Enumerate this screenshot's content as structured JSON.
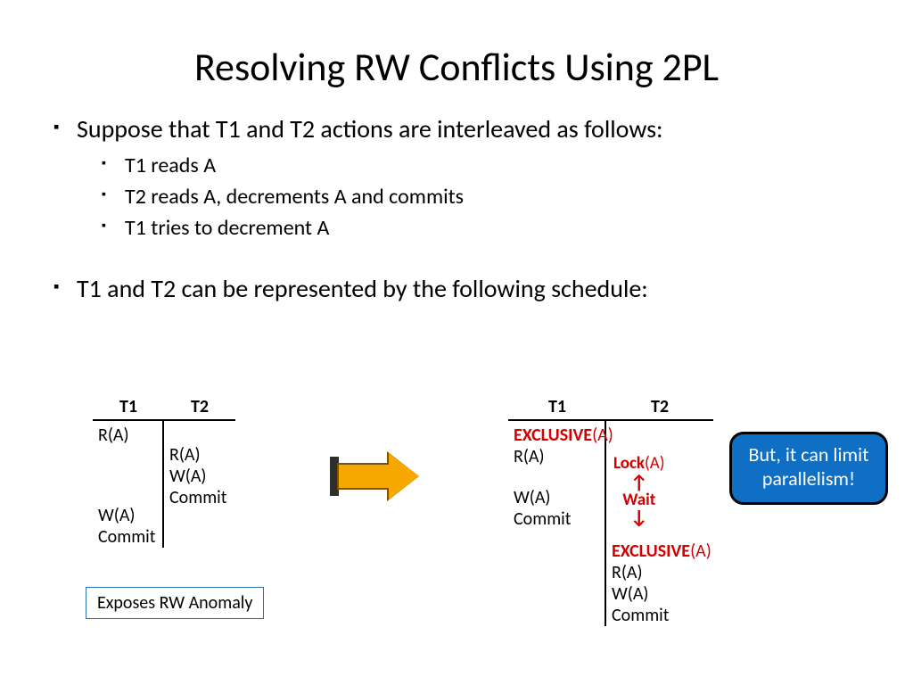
{
  "title": "Resolving RW Conflicts Using 2PL",
  "bullets": {
    "b1a": "Suppose that T1 and T2 actions are interleaved as follows:",
    "b2a": "T1 reads A",
    "b2b": "T2 reads A, decrements A and commits",
    "b2c": "T1 tries to decrement A",
    "b1b": "T1 and T2 can be represented by the following schedule:"
  },
  "left_table": {
    "h1": "T1",
    "h2": "T2",
    "t1": [
      "R(A)",
      "",
      "",
      "",
      "W(A)",
      "Commit"
    ],
    "t2": [
      "",
      "R(A)",
      "W(A)",
      "Commit",
      "",
      ""
    ]
  },
  "right_table": {
    "h1": "T1",
    "h2": "T2",
    "t1_ex": "EXCLUSIVE",
    "t1_exarg": "(A)",
    "t1": [
      "R(A)",
      "",
      "W(A)",
      "Commit"
    ],
    "t2_lock": "Lock",
    "t2_lockarg": "(A)",
    "t2_wait": "Wait",
    "t2_ex": "EXCLUSIVE",
    "t2_exarg": "(A)",
    "t2": [
      "R(A)",
      "W(A)",
      "Commit"
    ]
  },
  "anomaly": "Exposes RW Anomaly",
  "callout": "But, it can limit parallelism!"
}
